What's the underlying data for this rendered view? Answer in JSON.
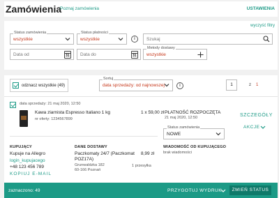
{
  "header": {
    "title": "Zamówienia",
    "intro_link": "Poznaj zamówienia",
    "settings_link": "USTAWIENIA"
  },
  "filters": {
    "more_link": "wyczyść filtry",
    "order_status": {
      "label": "Status zamówienia",
      "value": "wszystkie"
    },
    "payment_status": {
      "label": "Status płatności",
      "value": "wszystkie"
    },
    "search": {
      "placeholder": "Szukaj"
    },
    "date_from": {
      "placeholder": "Data od"
    },
    "date_to": {
      "placeholder": "Data do"
    },
    "delivery": {
      "label": "Metody dostawy",
      "value": "wszystkie"
    },
    "calendar_day": "31"
  },
  "list": {
    "select_all_label": "odznacz wszystkie (49)",
    "sort": {
      "label": "Sortuj",
      "value": "data sprzedaży: od najnowszej"
    },
    "page": {
      "current": "1",
      "of_label": "z",
      "total": "1"
    }
  },
  "order": {
    "date": "data sprzedaży: 21 maj 2020, 12:50",
    "product_name": "Kawa ziarnista Espresso Italiano 1 kg",
    "offer_no": "nr oferty: 1234567899",
    "qty_price": "1 x 59,00 zł",
    "payment_head": "PŁATNOŚĆ ROZPOCZĘTA",
    "payment_date": "21 maj 2020, 12:50",
    "details_link": "SZCZEGÓŁY",
    "actions_link": "AKCJE",
    "status": {
      "label": "Status zamówienia",
      "value": "NOWE"
    },
    "buyer": {
      "heading": "KUPUJĄCY",
      "name": "Kupuje na Allegro",
      "login": "login_kupujacego",
      "phone": "+48 123 456 789",
      "email_link": "KOPIUJ E-MAIL"
    },
    "delivery": {
      "heading": "DANE DOSTAWY",
      "method_line1": "Paczkomaty 24/7 (Paczkomat",
      "method_line2": "POZ17A)",
      "price": "8,99 zł",
      "address1": "Grunwaldzka 182",
      "address2": "60-166 Poznań",
      "packages": "1 przesyłka"
    },
    "message": {
      "heading": "WIADOMOŚĆ OD KUPUJĄCEGO",
      "text": "brak wiadomości"
    }
  },
  "footer": {
    "selected": "zaznaczono: 49",
    "prepare": "PRZYGOTUJ WYDRUK",
    "change_status": "ZMIEŃ STATUS"
  },
  "colors": {
    "accent": "#1c9a86",
    "value_red": "#c6371a"
  }
}
